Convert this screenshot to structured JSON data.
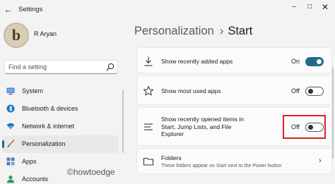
{
  "window": {
    "title": "Settings",
    "back_icon": "arrow-left-icon",
    "controls": {
      "minimize": "–",
      "maximize": "□",
      "close": "✕"
    }
  },
  "user": {
    "name": "R Aryan",
    "avatar_letter": "b"
  },
  "search": {
    "placeholder": "Find a setting",
    "icon": "search-icon"
  },
  "sidebar": {
    "items": [
      {
        "label": "System",
        "icon": "monitor-icon",
        "active": false
      },
      {
        "label": "Bluetooth & devices",
        "icon": "bluetooth-icon",
        "active": false
      },
      {
        "label": "Network & internet",
        "icon": "wifi-icon",
        "active": false
      },
      {
        "label": "Personalization",
        "icon": "brush-icon",
        "active": true
      },
      {
        "label": "Apps",
        "icon": "apps-icon",
        "active": false
      },
      {
        "label": "Accounts",
        "icon": "account-icon",
        "active": false
      }
    ]
  },
  "breadcrumb": {
    "parent": "Personalization",
    "separator": "›",
    "current": "Start"
  },
  "settings": {
    "recently_added": {
      "label": "Show recently added apps",
      "state": "On",
      "on": true,
      "icon": "download-icon"
    },
    "most_used": {
      "label": "Show most used apps",
      "state": "Off",
      "on": false,
      "icon": "star-icon"
    },
    "recently_opened": {
      "label_line1": "Show recently opened items in",
      "label_line2": "Start, Jump Lists, and File",
      "label_line3": "Explorer",
      "state": "Off",
      "on": false,
      "icon": "list-icon"
    },
    "folders": {
      "label": "Folders",
      "description": "These folders appear on Start next to the Power button",
      "icon": "folder-icon"
    }
  },
  "watermark": "©howtoedge",
  "colors": {
    "accent": "#1f6b8a",
    "highlight": "#e0201b",
    "background": "#f3f3f3"
  }
}
